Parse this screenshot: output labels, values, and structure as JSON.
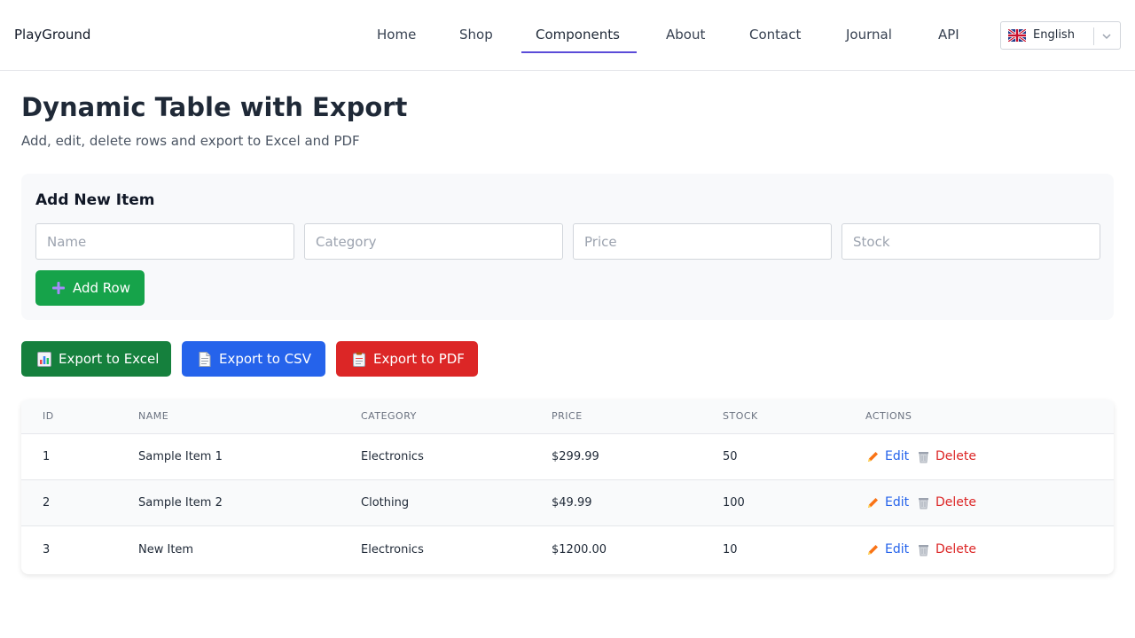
{
  "header": {
    "brand": "PlayGround",
    "nav": [
      "Home",
      "Shop",
      "Components",
      "About",
      "Contact",
      "Journal",
      "API"
    ],
    "active_nav": "Components",
    "language": "English"
  },
  "page": {
    "title": "Dynamic Table with Export",
    "subtitle": "Add, edit, delete rows and export to Excel and PDF"
  },
  "add_form": {
    "title": "Add New Item",
    "placeholders": {
      "name": "Name",
      "category": "Category",
      "price": "Price",
      "stock": "Stock"
    },
    "add_label": "Add Row"
  },
  "exports": {
    "excel": "Export to Excel",
    "csv": "Export to CSV",
    "pdf": "Export to PDF"
  },
  "table": {
    "headers": [
      "ID",
      "NAME",
      "CATEGORY",
      "PRICE",
      "STOCK",
      "ACTIONS"
    ],
    "rows": [
      {
        "id": "1",
        "name": "Sample Item 1",
        "category": "Electronics",
        "price": "$299.99",
        "stock": "50"
      },
      {
        "id": "2",
        "name": "Sample Item 2",
        "category": "Clothing",
        "price": "$49.99",
        "stock": "100"
      },
      {
        "id": "3",
        "name": "New Item",
        "category": "Electronics",
        "price": "$1200.00",
        "stock": "10"
      }
    ],
    "edit_label": "Edit",
    "delete_label": "Delete"
  },
  "colors": {
    "accent": "#5b4bd8",
    "add_green": "#16a34a",
    "excel_green": "#15803d",
    "csv_blue": "#2563eb",
    "pdf_red": "#dc2626",
    "edit_blue": "#2563eb",
    "delete_red": "#dc2626"
  },
  "icons": [
    "uk-flag-icon",
    "chevron-down-icon",
    "plus-icon",
    "bar-chart-icon",
    "document-icon",
    "clipboard-icon",
    "pencil-icon",
    "trash-icon"
  ]
}
